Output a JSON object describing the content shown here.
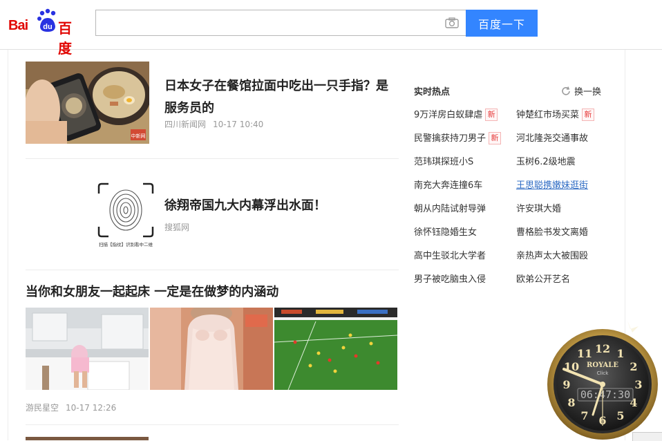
{
  "header": {
    "logo_text_latin": "Bai",
    "logo_text_du": "du",
    "logo_text_cn": "百度",
    "search_value": "",
    "search_button_label": "百度一下"
  },
  "feed": {
    "news1": {
      "title": "日本女子在餐馆拉面中吃出一只手指？是服务员的",
      "source": "四川新闻网",
      "time": "10-17 10:40",
      "image_watermark": "中新网"
    },
    "news2": {
      "title": "徐翔帝国九大内幕浮出水面！",
      "source": "搜狐网",
      "image_caption": "扫描【指纹】识别看中二维"
    },
    "news3": {
      "title": "当你和女朋友一起起床 一定是在做梦的内涵动",
      "source": "游民星空",
      "time": "10-17 12:26"
    }
  },
  "hot": {
    "title": "实时热点",
    "refresh_label": "换一换",
    "new_badge": "新",
    "items": [
      {
        "label": "9万洋房白蚁肆虐",
        "new": true
      },
      {
        "label": "钟楚红市场买菜",
        "new": true
      },
      {
        "label": "民警擒获持刀男子",
        "new": true
      },
      {
        "label": "河北隆尧交通事故",
        "new": false
      },
      {
        "label": "范玮琪探班小S",
        "new": false
      },
      {
        "label": "玉树6.2级地震",
        "new": false
      },
      {
        "label": "南充大奔连撞6车",
        "new": false
      },
      {
        "label": "王思聪携嫩妹逛街",
        "new": false
      },
      {
        "label": "朝从内陆试射导弹",
        "new": false
      },
      {
        "label": "许安琪大婚",
        "new": false
      },
      {
        "label": "徐怀钰隐婚生女",
        "new": false
      },
      {
        "label": "曹格脸书发文离婚",
        "new": false
      },
      {
        "label": "高中生驳北大学者",
        "new": false
      },
      {
        "label": "亲热声太大被围殴",
        "new": false
      },
      {
        "label": "男子被吃脑虫入侵",
        "new": false
      },
      {
        "label": "欧弟公开艺名",
        "new": false
      }
    ]
  },
  "clock": {
    "brand": "ROYALE",
    "subbrand": "Click",
    "time_readout": "06:47:30",
    "numerals": [
      "12",
      "1",
      "2",
      "3",
      "4",
      "5",
      "6",
      "7",
      "8",
      "9",
      "10",
      "11"
    ]
  },
  "colors": {
    "accent": "#3385ff",
    "logo_red": "#e10602",
    "logo_blue": "#2932e1",
    "link_blue": "#2f6cc4"
  }
}
